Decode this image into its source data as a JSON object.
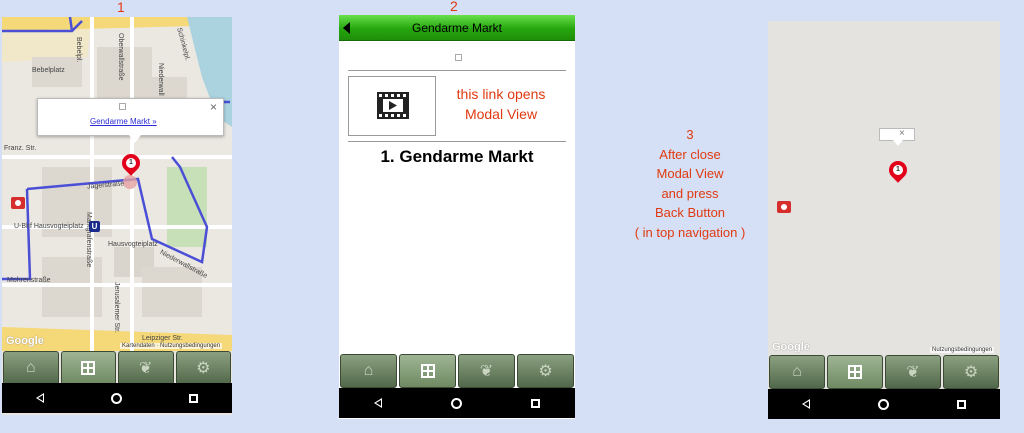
{
  "labels": {
    "one": "1",
    "two": "2",
    "three": "3"
  },
  "screen1": {
    "popup_link": "Gendarme Markt »",
    "close": "×",
    "pin_number": "1",
    "streets": {
      "bebelplatz": "Bebelplatz",
      "bebelpl": "Bebelpl.",
      "oberwall": "Oberwallstraße",
      "niederwall": "Niederwall",
      "schinkel": "Schinkelpl.",
      "franz": "Franz. Str.",
      "markgrafen": "Markgrafenstraße",
      "jaeger": "Jägerstraße",
      "hausvogtei_ubf": "U-Bhf Hausvogteiplatz",
      "hausvogteiplatz": "Hausvogteiplatz",
      "niederwallstr": "Niederwallstraße",
      "mohren": "Mohrenstraße",
      "jerusalemer": "Jerusalemer Str.",
      "leipziger": "Leipziger Str."
    },
    "google": "Google",
    "terms": "Kartendaten · Nutzungsbedingungen",
    "ubahn": "U"
  },
  "screen2": {
    "title": "Gendarme Markt",
    "link_text_1": "this link opens",
    "link_text_2": "Modal View",
    "heading": "1. Gendarme Markt"
  },
  "instruction": {
    "number": "3",
    "lines": [
      "After close",
      "Modal View",
      "and press",
      "Back Button",
      "( in top navigation )"
    ]
  },
  "screen3": {
    "pin_number": "1",
    "close": "×",
    "google": "Google",
    "terms": "Nutzungsbedingungen"
  },
  "tabs": [
    {
      "icon": "home-icon",
      "glyph": "⌂"
    },
    {
      "icon": "grid-icon",
      "glyph": ""
    },
    {
      "icon": "paw-icon",
      "glyph": "❦"
    },
    {
      "icon": "gear-icon",
      "glyph": "⚙"
    }
  ],
  "colors": {
    "accent_red": "#e03a10",
    "route": "#4a4fd6",
    "tab_green": "#6f8a63",
    "header_green": "#33c21a"
  }
}
